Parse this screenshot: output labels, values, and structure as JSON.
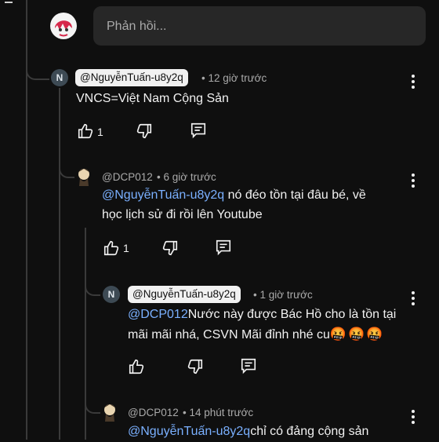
{
  "reply_input": {
    "placeholder": "Phản hồi..."
  },
  "comments": [
    {
      "handle": "@NguyễnTuấn-u8y2q",
      "time": "• 12 giờ trước",
      "text": "VNCS=Việt Nam Cộng Sản",
      "likes": "1",
      "avatar_letter": "N"
    },
    {
      "handle": "@DCP012",
      "time": "• 6 giờ trước",
      "mention": "@NguyễnTuấn-u8y2q",
      "text_line1": " nó đéo tồn tại đâu bé, về",
      "text_line2": "học lịch sử đi rồi lên Youtube",
      "likes": "1"
    },
    {
      "handle": "@NguyễnTuấn-u8y2q",
      "time": "• 1 giờ trước",
      "mention": "@DCP012",
      "text_line1": "Nước này được Bác Hồ cho là tồn tại",
      "text_line2": "mãi mãi nhá, CSVN Mãi đỉnh nhé cu",
      "emoji": "🤬🤬🤬",
      "avatar_letter": "N"
    },
    {
      "handle": "@DCP012",
      "time": "• 14 phút trước",
      "mention": "@NguyễnTuấn-u8y2q",
      "text_line1": "chỉ có đảng cộng sản"
    }
  ]
}
